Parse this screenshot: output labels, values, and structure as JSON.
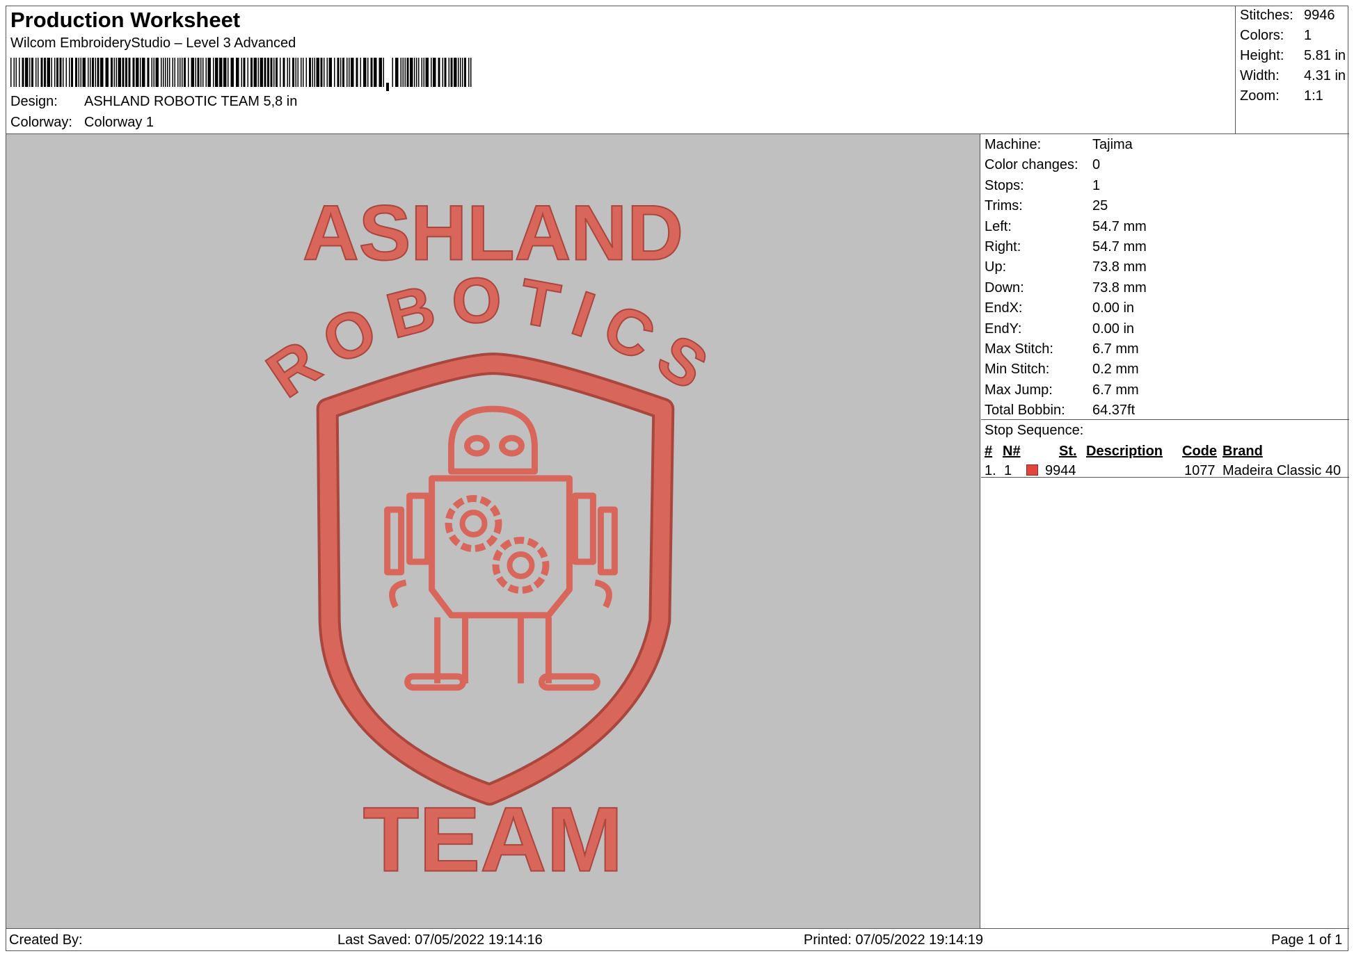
{
  "header": {
    "title": "Production Worksheet",
    "software": "Wilcom EmbroideryStudio – Level 3 Advanced",
    "design_label": "Design:",
    "design_value": "ASHLAND ROBOTIC TEAM 5,8 in",
    "colorway_label": "Colorway:",
    "colorway_value": "Colorway 1"
  },
  "stats": [
    {
      "label": "Stitches:",
      "value": "9946"
    },
    {
      "label": "Colors:",
      "value": "1"
    },
    {
      "label": "Height:",
      "value": "5.81 in"
    },
    {
      "label": "Width:",
      "value": "4.31 in"
    },
    {
      "label": "Zoom:",
      "value": "1:1"
    }
  ],
  "machine_info": [
    {
      "label": "Machine:",
      "value": "Tajima"
    },
    {
      "label": "Color changes:",
      "value": "0"
    },
    {
      "label": "Stops:",
      "value": "1"
    },
    {
      "label": "Trims:",
      "value": "25"
    },
    {
      "label": "Left:",
      "value": "54.7 mm"
    },
    {
      "label": "Right:",
      "value": "54.7 mm"
    },
    {
      "label": "Up:",
      "value": "73.8 mm"
    },
    {
      "label": "Down:",
      "value": "73.8 mm"
    },
    {
      "label": "EndX:",
      "value": "0.00 in"
    },
    {
      "label": "EndY:",
      "value": "0.00 in"
    },
    {
      "label": "Max Stitch:",
      "value": "6.7 mm"
    },
    {
      "label": "Min Stitch:",
      "value": "0.2 mm"
    },
    {
      "label": "Max Jump:",
      "value": "6.7 mm"
    },
    {
      "label": "Total Bobbin:",
      "value": "64.37ft"
    }
  ],
  "stop_sequence": {
    "label": "Stop Sequence:",
    "columns": {
      "num": "#",
      "needle": "N#",
      "stitches": "St.",
      "description": "Description",
      "code": "Code",
      "brand": "Brand"
    },
    "rows": [
      {
        "num": "1.",
        "needle": "1",
        "color": "#e0463c",
        "stitches": "9944",
        "description": "",
        "code": "1077",
        "brand": "Madeira Classic 40"
      }
    ]
  },
  "design": {
    "thread_color": "#d9665a",
    "thread_shadow": "#a9463d",
    "background": "#c0c0c0",
    "text_top": "ASHLAND",
    "text_arc": "ROBOTICS",
    "text_bottom": "TEAM",
    "icons": [
      "shield-icon",
      "robot-icon",
      "gear-icon"
    ]
  },
  "footer": {
    "created_by": "Created By:",
    "last_saved": "Last Saved: 07/05/2022 19:14:16",
    "printed": "Printed: 07/05/2022 19:14:19",
    "page": "Page 1 of 1"
  }
}
